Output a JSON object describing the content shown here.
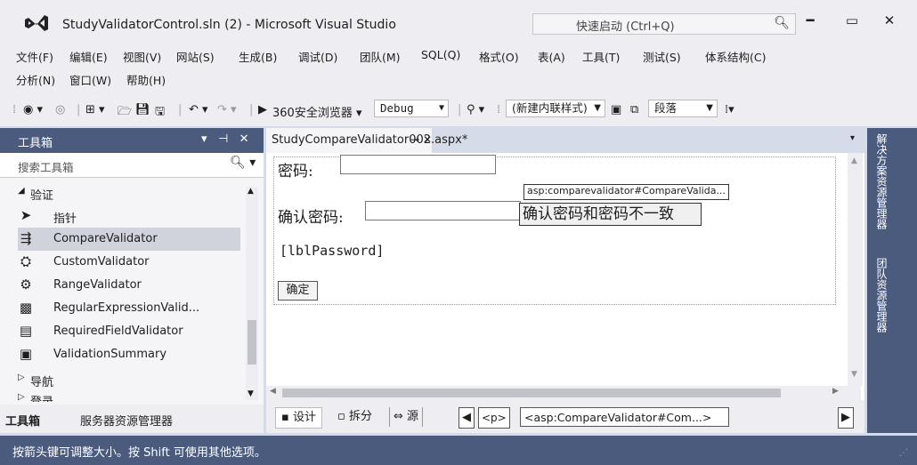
{
  "window": {
    "title": "StudyValidatorControl.sln (2) - Microsoft Visual Studio",
    "quick_launch": "快速启动 (Ctrl+Q)"
  },
  "menu": {
    "row1": [
      "文件(F)",
      "编辑(E)",
      "视图(V)",
      "网站(S)",
      "生成(B)",
      "调试(D)",
      "团队(M)",
      "SQL(Q)",
      "格式(O)",
      "表(A)",
      "工具(T)",
      "测试(S)",
      "体系结构(C)"
    ],
    "row2": [
      "分析(N)",
      "窗口(W)",
      "帮助(H)"
    ]
  },
  "toolbar": {
    "browser": "360安全浏览器",
    "config": "Debug",
    "style_combo": "(新建内联样式)",
    "block_combo": "段落"
  },
  "toolbox": {
    "title": "工具箱",
    "search_placeholder": "搜索工具箱",
    "group_validation": "验证",
    "items": [
      {
        "label": "指针",
        "icon": "pointer-icon"
      },
      {
        "label": "CompareValidator",
        "icon": "compare-validator-icon"
      },
      {
        "label": "CustomValidator",
        "icon": "custom-validator-icon"
      },
      {
        "label": "RangeValidator",
        "icon": "range-validator-icon"
      },
      {
        "label": "RegularExpressionValid...",
        "icon": "regex-validator-icon"
      },
      {
        "label": "RequiredFieldValidator",
        "icon": "required-validator-icon"
      },
      {
        "label": "ValidationSummary",
        "icon": "validation-summary-icon"
      }
    ],
    "group_nav": "导航",
    "group_login": "登录",
    "tab_toolbox": "工具箱",
    "tab_server": "服务器资源管理器"
  },
  "editor": {
    "tab_title": "StudyCompareValidator002.aspx*",
    "password_label": "密码:",
    "confirm_label": "确认密码:",
    "validator_tag": "asp:comparevalidator#CompareValida...",
    "error_message": "确认密码和密码不一致",
    "lbl_password": "[lblPassword]",
    "ok_button": "确定",
    "view_design": "设计",
    "view_split": "拆分",
    "view_source": "源",
    "crumb_p": "<p>",
    "crumb_tag": "<asp:CompareValidator#Com...>"
  },
  "right_strip": {
    "tab1": "解决方案资源管理器",
    "tab2": "团队资源管理器"
  },
  "status": {
    "text": "按箭头键可调整大小。按 Shift 可使用其他选项。"
  }
}
